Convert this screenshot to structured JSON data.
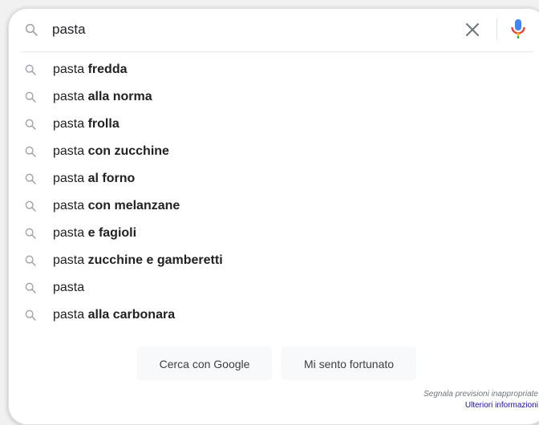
{
  "search": {
    "query": "pasta",
    "clear_icon": "close-icon",
    "mic_icon": "microphone-icon",
    "search_icon": "search-icon"
  },
  "suggestions": [
    {
      "prefix": "pasta",
      "completion": "fredda"
    },
    {
      "prefix": "pasta",
      "completion": "alla norma"
    },
    {
      "prefix": "pasta",
      "completion": "frolla"
    },
    {
      "prefix": "pasta",
      "completion": "con zucchine"
    },
    {
      "prefix": "pasta",
      "completion": "al forno"
    },
    {
      "prefix": "pasta",
      "completion": "con melanzane"
    },
    {
      "prefix": "pasta",
      "completion": "e fagioli"
    },
    {
      "prefix": "pasta",
      "completion": "zucchine e gamberetti"
    },
    {
      "prefix": "pasta",
      "completion": ""
    },
    {
      "prefix": "pasta",
      "completion": "alla carbonara"
    }
  ],
  "buttons": {
    "search_label": "Cerca con Google",
    "lucky_label": "Mi sento fortunato"
  },
  "footer": {
    "report_text": "Segnala previsioni inappropriate",
    "more_info": "Ulteriori informazioni"
  },
  "colors": {
    "mic_blue": "#4285f4",
    "mic_red": "#ea4335",
    "link": "#1a0dab"
  }
}
